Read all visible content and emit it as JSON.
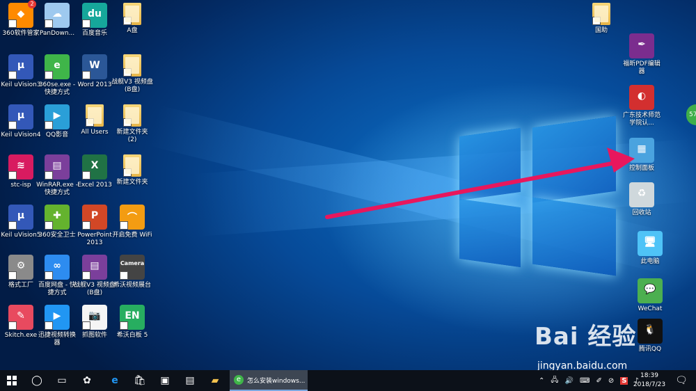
{
  "desktop_icons": [
    {
      "label": "360软件管家",
      "icon": "360-softmanager-icon",
      "color": "#ff8a00",
      "glyph": "◆",
      "badge": "2"
    },
    {
      "label": "PanDown...",
      "icon": "pandownload-cloud-icon",
      "color": "#9ec9ef",
      "glyph": "☁"
    },
    {
      "label": "百度音乐",
      "icon": "baidu-music-icon",
      "color": "#16a79b",
      "glyph": "du"
    },
    {
      "label": "A盘",
      "icon": "folder-icon",
      "color": "#f0c45c",
      "glyph": ""
    },
    {
      "label": "Keil uVision3",
      "icon": "keil-uvision-icon",
      "color": "#3358b8",
      "glyph": "μ"
    },
    {
      "label": "360se.exe - 快捷方式",
      "icon": "360-browser-icon",
      "color": "#3fb549",
      "glyph": "e"
    },
    {
      "label": "Word 2013",
      "icon": "word-icon",
      "color": "#2b5797",
      "glyph": "W"
    },
    {
      "label": "战舰V3 视频盘(B盘)",
      "icon": "folder-icon",
      "color": "#f0c45c",
      "glyph": ""
    },
    {
      "label": "Keil uVision4",
      "icon": "keil-uvision-icon",
      "color": "#3358b8",
      "glyph": "μ"
    },
    {
      "label": "QQ影音",
      "icon": "qq-player-icon",
      "color": "#2a9fd8",
      "glyph": "▶"
    },
    {
      "label": "All Users",
      "icon": "folder-icon",
      "color": "#f0c45c",
      "glyph": ""
    },
    {
      "label": "新建文件夹 (2)",
      "icon": "folder-icon",
      "color": "#f0c45c",
      "glyph": ""
    },
    {
      "label": "stc-isp",
      "icon": "stc-isp-icon",
      "color": "#d81b60",
      "glyph": "≋"
    },
    {
      "label": "WinRAR.exe - 快捷方式",
      "icon": "winrar-icon",
      "color": "#7b3f9b",
      "glyph": "▤"
    },
    {
      "label": "Excel 2013",
      "icon": "excel-icon",
      "color": "#207245",
      "glyph": "X"
    },
    {
      "label": "新建文件夹",
      "icon": "folder-icon",
      "color": "#f0c45c",
      "glyph": ""
    },
    {
      "label": "Keil uVision5",
      "icon": "keil-uvision-icon",
      "color": "#3358b8",
      "glyph": "μ"
    },
    {
      "label": "360安全卫士",
      "icon": "360-safe-icon",
      "color": "#64b32e",
      "glyph": "✚"
    },
    {
      "label": "PowerPoint 2013",
      "icon": "powerpoint-icon",
      "color": "#d24726",
      "glyph": "P"
    },
    {
      "label": "开启免费 WiFi",
      "icon": "wifi-icon",
      "color": "#f39c12",
      "glyph": "⌒"
    },
    {
      "label": "格式工厂",
      "icon": "format-factory-icon",
      "color": "#8a8a8a",
      "glyph": "⚙"
    },
    {
      "label": "百度网盘 - 快捷方式",
      "icon": "baidu-netdisk-icon",
      "color": "#2d8cf0",
      "glyph": "∞"
    },
    {
      "label": "战舰V3 视频盘(B盘)",
      "icon": "winrar-icon",
      "color": "#7b3f9b",
      "glyph": "▤"
    },
    {
      "label": "希沃视频展台",
      "icon": "camera-icon",
      "color": "#444444",
      "glyph": "Camera"
    },
    {
      "label": "Skitch.exe",
      "icon": "skitch-icon",
      "color": "#e84a5f",
      "glyph": "✎"
    },
    {
      "label": "迅捷视频转换器",
      "icon": "video-converter-icon",
      "color": "#2196f3",
      "glyph": "▶"
    },
    {
      "label": "抓图软件",
      "icon": "screenshot-camera-icon",
      "color": "#f5f5f5",
      "glyph": "📷"
    },
    {
      "label": "希沃白板 5",
      "icon": "seewo-board-icon",
      "color": "#27ae60",
      "glyph": "EN"
    }
  ],
  "right_icons": [
    {
      "label": "国助",
      "icon": "folder-icon",
      "color": "#f0c45c",
      "glyph": ""
    },
    {
      "label": "福昕PDF编辑器",
      "icon": "foxit-pdf-icon",
      "color": "#7b2d8e",
      "glyph": "✒"
    },
    {
      "label": "广东技术师范学院认...",
      "icon": "browser-icon",
      "color": "#d32f2f",
      "glyph": "◐"
    },
    {
      "label": "控制面板",
      "icon": "control-panel-icon",
      "color": "#4aa3df",
      "glyph": "▦"
    },
    {
      "label": "回收站",
      "icon": "recycle-bin-icon",
      "color": "#cfd8dc",
      "glyph": "♻"
    },
    {
      "label": "此电脑",
      "icon": "this-pc-icon",
      "color": "#4fc3f7",
      "glyph": "🖥"
    },
    {
      "label": "WeChat",
      "icon": "wechat-icon",
      "color": "#4caf50",
      "glyph": "💬"
    },
    {
      "label": "腾讯QQ",
      "icon": "qq-icon",
      "color": "#111111",
      "glyph": "🐧"
    }
  ],
  "watermark": {
    "brand": "Bai 经验",
    "site": "jingyan.baidu.com"
  },
  "edge_badge": "57",
  "taskbar": {
    "active_task_label": "怎么安装windows...",
    "time": "18:39",
    "date": "2018/7/23",
    "tray_s_label": "S"
  },
  "colors": {
    "arrow": "#e8175d",
    "taskbar": "#0c1119",
    "active_task": "#3d4653"
  }
}
